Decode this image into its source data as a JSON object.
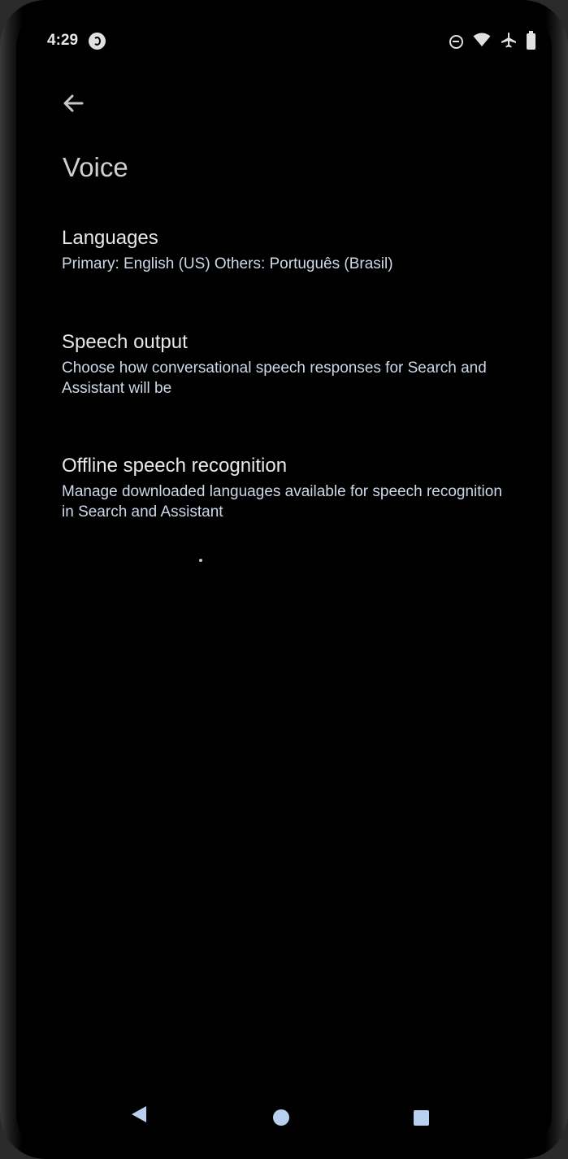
{
  "status_bar": {
    "time": "4:29",
    "icons": [
      "app-notification-icon",
      "do-not-disturb-icon",
      "wifi-icon",
      "airplane-icon",
      "battery-icon"
    ]
  },
  "header": {
    "back_icon": "arrow-back-icon",
    "title": "Voice"
  },
  "settings": [
    {
      "title": "Languages",
      "summary": "Primary: English (US) Others: Português (Brasil)"
    },
    {
      "title": "Speech output",
      "summary": "Choose how conversational speech responses for Search and Assistant will be"
    },
    {
      "title": "Offline speech recognition",
      "summary": "Manage downloaded languages available for speech recognition in Search and Assistant"
    }
  ],
  "nav_bar": {
    "back_icon": "nav-back-triangle-icon",
    "home_icon": "nav-home-circle-icon",
    "recents_icon": "nav-recents-square-icon"
  },
  "colors": {
    "background": "#000000",
    "title_text": "#e8e8e8",
    "summary_text": "#cdd8e8",
    "nav_accent": "#b8d0ee"
  }
}
